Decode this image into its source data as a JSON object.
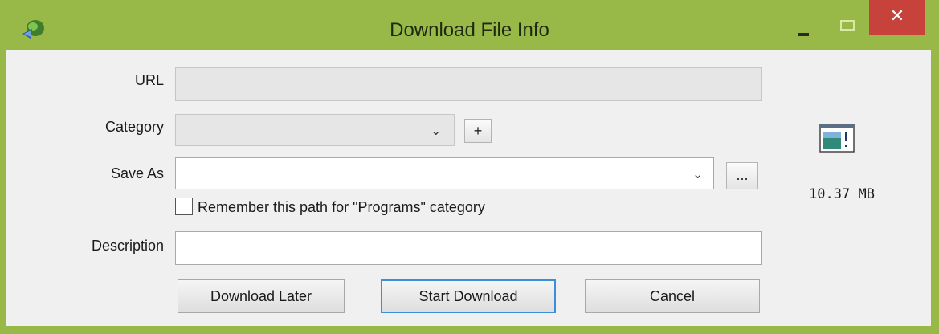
{
  "window": {
    "title": "Download File Info",
    "close_glyph": "✕"
  },
  "form": {
    "url_label": "URL",
    "url_value": "",
    "category_label": "Category",
    "category_value": "",
    "category_add_label": "+",
    "save_as_label": "Save As",
    "save_as_value": "",
    "browse_label": "...",
    "remember_label": "Remember this path for \"Programs\" category",
    "remember_checked": false,
    "description_label": "Description",
    "description_value": ""
  },
  "file": {
    "size": "10.37 MB",
    "icon": "file-window-icon"
  },
  "buttons": {
    "download_later": "Download Later",
    "start_download": "Start Download",
    "cancel": "Cancel"
  },
  "colors": {
    "titlebar": "#98b848",
    "close": "#c7423b",
    "default_button_border": "#3c8ed6"
  }
}
